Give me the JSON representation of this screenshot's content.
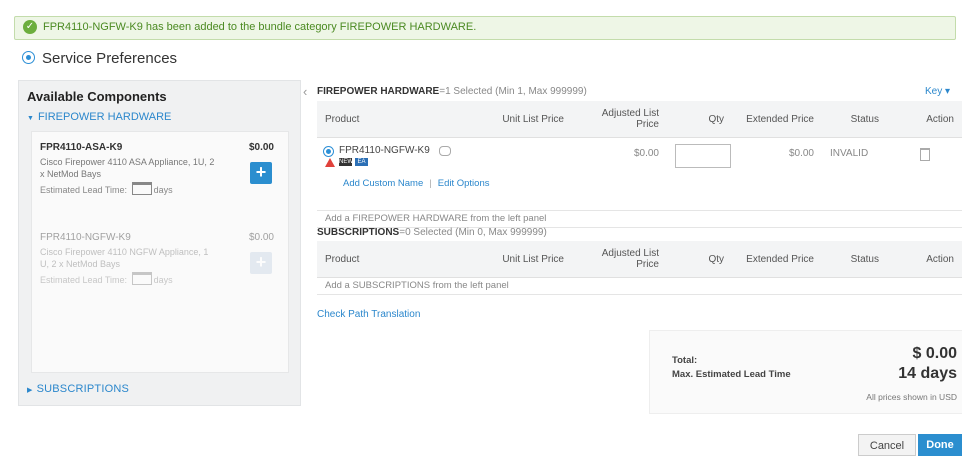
{
  "banner": {
    "message": "FPR4110-NGFW-K9 has been added to the bundle category FIREPOWER HARDWARE.",
    "icon": "check-circle-icon"
  },
  "service_preferences": {
    "label": "Service Preferences"
  },
  "left_panel": {
    "title": "Available Components",
    "category": "FIREPOWER HARDWARE",
    "components": [
      {
        "name": "FPR4110-ASA-K9",
        "price": "$0.00",
        "description": "Cisco Firepower 4110 ASA Appliance, 1U, 2 x NetMod Bays",
        "lead_prefix": "Estimated Lead Time:",
        "lead_suffix": "days",
        "enabled": true
      },
      {
        "name": "FPR4110-NGFW-K9",
        "price": "$0.00",
        "description": "Cisco Firepower 4110 NGFW Appliance, 1 U, 2 x NetMod Bays",
        "lead_prefix": "Estimated Lead Time:",
        "lead_suffix": "days",
        "enabled": false
      }
    ],
    "subscriptions_label": "SUBSCRIPTIONS"
  },
  "hardware_section": {
    "title": "FIREPOWER HARDWARE",
    "summary": "=1 Selected (Min 1, Max 999999)",
    "key_label": "Key",
    "columns": [
      "Product",
      "Unit List Price",
      "Adjusted List Price",
      "Qty",
      "Extended Price",
      "Status",
      "Action"
    ],
    "rows": [
      {
        "product": "FPR4110-NGFW-K9",
        "badge1": "NEW",
        "badge2": "EA",
        "unit_list_price": "",
        "adjusted_list_price": "$0.00",
        "qty": "",
        "extended_price": "$0.00",
        "status": "INVALID",
        "add_custom_name": "Add Custom Name",
        "edit_options": "Edit Options"
      }
    ],
    "add_hint": "Add a FIREPOWER HARDWARE from the left panel"
  },
  "subscriptions_section": {
    "title": "SUBSCRIPTIONS",
    "summary": "=0 Selected (Min 0, Max 999999)",
    "columns": [
      "Product",
      "Unit List Price",
      "Adjusted List Price",
      "Qty",
      "Extended Price",
      "Status",
      "Action"
    ],
    "add_hint": "Add a SUBSCRIPTIONS from the left panel"
  },
  "check_path_label": "Check Path Translation",
  "totals": {
    "total_label": "Total:",
    "total_value": "$ 0.00",
    "lead_label": "Max. Estimated Lead Time",
    "lead_value": "14 days",
    "note": "All prices shown in USD"
  },
  "buttons": {
    "cancel": "Cancel",
    "done": "Done"
  },
  "colors": {
    "accent": "#2b8ecf",
    "success": "#6cae3e",
    "warning": "#e0413b"
  }
}
